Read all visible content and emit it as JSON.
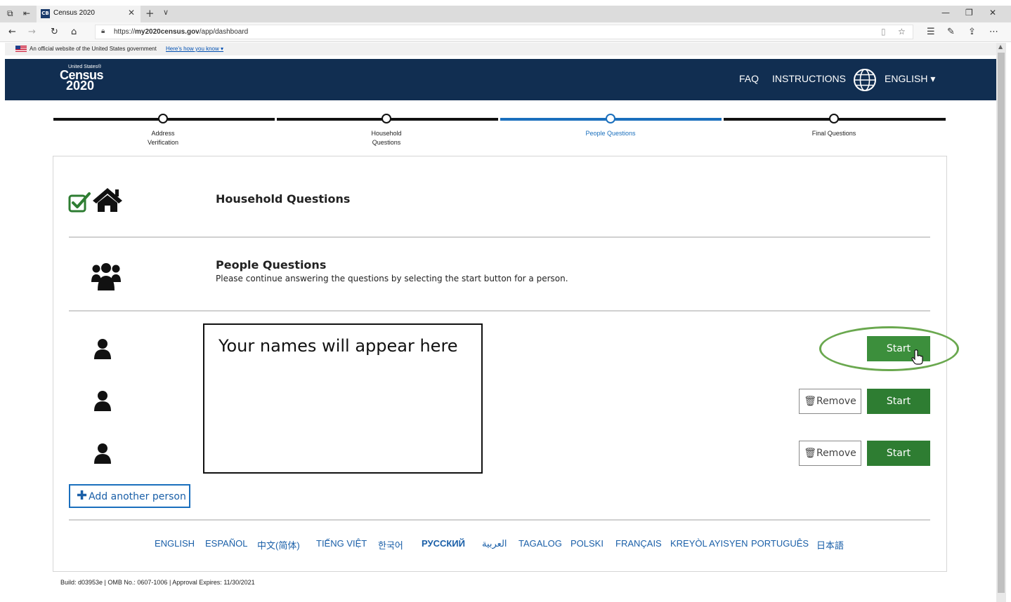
{
  "browser": {
    "tab_title": "Census 2020",
    "favicon_text": "CB",
    "url_scheme": "https://",
    "url_host": "my2020census.gov",
    "url_path": "/app/dashboard"
  },
  "gov_banner": {
    "text": "An official website of the United States government",
    "link": "Here's how you know ▾"
  },
  "header": {
    "logo_us": "United States®",
    "logo_census": "Census",
    "logo_year": "2020",
    "nav": [
      "FAQ",
      "INSTRUCTIONS"
    ],
    "language": "ENGLISH ▾"
  },
  "progress": {
    "steps": [
      {
        "line1": "Address",
        "line2": "Verification"
      },
      {
        "line1": "Household",
        "line2": "Questions"
      },
      {
        "line1": "People Questions",
        "line2": ""
      },
      {
        "line1": "Final Questions",
        "line2": ""
      }
    ],
    "current_step": "People Questions"
  },
  "sections": {
    "household_title": "Household Questions",
    "people_title": "People Questions",
    "people_desc": "Please continue answering the questions by selecting the start button for a person."
  },
  "names_placeholder": "Your names will appear here",
  "people_rows": [
    {
      "start": "Start",
      "remove": ""
    },
    {
      "start": "Start",
      "remove": "Remove"
    },
    {
      "start": "Start",
      "remove": "Remove"
    }
  ],
  "add_person": "Add another person",
  "footer_languages": [
    "ENGLISH",
    "ESPAÑOL",
    "中文(简体)",
    "TIẾNG VIỆT",
    "한국어",
    "РУССКИЙ",
    "العربية",
    "TAGALOG",
    "POLSKI",
    "FRANÇAIS",
    "KREYÒL AYISYEN",
    "PORTUGUÊS",
    "日本語"
  ],
  "build_info": "Build: d03953e  |  OMB No.: 0607-1006  |  Approval Expires: 11/30/2021",
  "colors": {
    "header_bg": "#112e51",
    "start_green": "#2e7d32",
    "active_blue": "#1a6fbd",
    "annotation_green": "#6aa84f"
  }
}
